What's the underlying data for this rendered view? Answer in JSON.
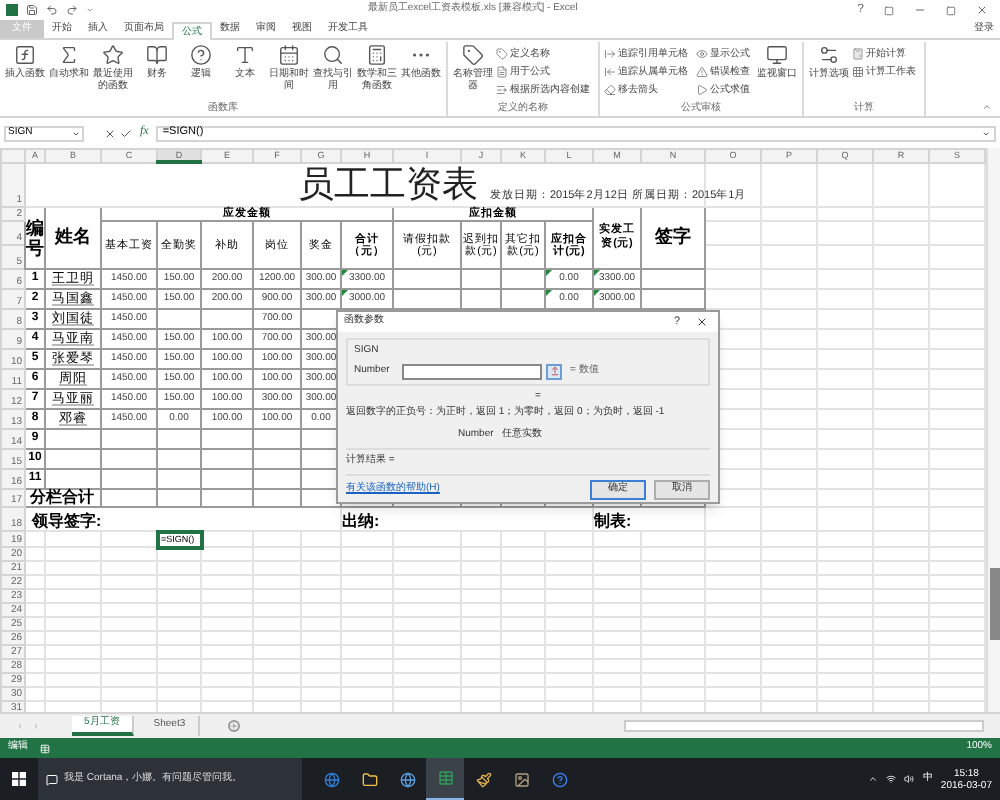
{
  "window": {
    "title": "最新员工excel工资表模板.xls  [兼容模式] - Excel",
    "help": "?"
  },
  "ribbon_tabs": [
    {
      "label": "文件",
      "kind": "file",
      "selected": false
    },
    {
      "label": "开始",
      "kind": "tab",
      "selected": false
    },
    {
      "label": "插入",
      "kind": "tab",
      "selected": false
    },
    {
      "label": "页面布局",
      "kind": "tab",
      "selected": false
    },
    {
      "label": "公式",
      "kind": "tab",
      "selected": true
    },
    {
      "label": "数据",
      "kind": "tab",
      "selected": false
    },
    {
      "label": "审阅",
      "kind": "tab",
      "selected": false
    },
    {
      "label": "视图",
      "kind": "tab",
      "selected": false
    },
    {
      "label": "开发工具",
      "kind": "tab",
      "selected": false
    }
  ],
  "sign_in": "登录",
  "ribbon_groups": [
    {
      "label": "函数库",
      "items": [
        {
          "label": "插入函数",
          "kind": "large"
        },
        {
          "label": "自动求和",
          "kind": "large"
        },
        {
          "label": "最近使用的函数",
          "kind": "large"
        },
        {
          "label": "财务",
          "kind": "large"
        },
        {
          "label": "逻辑",
          "kind": "large"
        },
        {
          "label": "文本",
          "kind": "large"
        },
        {
          "label": "日期和时间",
          "kind": "large"
        },
        {
          "label": "查找与引用",
          "kind": "large"
        },
        {
          "label": "数学和三角函数",
          "kind": "large"
        },
        {
          "label": "其他函数",
          "kind": "large"
        }
      ]
    },
    {
      "label": "定义的名称",
      "items": [
        {
          "label": "名称管理器",
          "kind": "large"
        },
        {
          "label": "定义名称",
          "kind": "small"
        },
        {
          "label": "用于公式",
          "kind": "small"
        },
        {
          "label": "根据所选内容创建",
          "kind": "small"
        }
      ]
    },
    {
      "label": "公式审核",
      "items": [
        {
          "label": "追踪引用单元格",
          "kind": "small"
        },
        {
          "label": "追踪从属单元格",
          "kind": "small"
        },
        {
          "label": "移去箭头",
          "kind": "small"
        },
        {
          "label": "显示公式",
          "kind": "small"
        },
        {
          "label": "错误检查",
          "kind": "small"
        },
        {
          "label": "公式求值",
          "kind": "small"
        },
        {
          "label": "监视窗口",
          "kind": "large"
        }
      ]
    },
    {
      "label": "计算",
      "items": [
        {
          "label": "计算选项",
          "kind": "large"
        },
        {
          "label": "开始计算",
          "kind": "small"
        },
        {
          "label": "计算工作表",
          "kind": "small"
        }
      ]
    }
  ],
  "formula_bar": {
    "name_box": "SIGN",
    "fx_label": "fx",
    "formula": "=SIGN()"
  },
  "sheet": {
    "columns": [
      "A",
      "B",
      "C",
      "D",
      "E",
      "F",
      "G",
      "H",
      "I",
      "J",
      "K",
      "L",
      "M",
      "N",
      "O",
      "P",
      "Q",
      "R",
      "S"
    ],
    "row_numbers": [
      "1",
      "2",
      "4",
      "5",
      "6",
      "7",
      "8",
      "9",
      "10",
      "11",
      "12",
      "13",
      "14",
      "15",
      "16",
      "17",
      "18",
      "19",
      "20",
      "21",
      "22",
      "23",
      "24",
      "25",
      "26",
      "27",
      "28",
      "29",
      "30",
      "31"
    ],
    "title": "员工工资表",
    "issue_info": "发放日期：2015年2月12日 所属日期：2015年1月",
    "headers": {
      "no": "编号",
      "name": "姓名",
      "payable": "应发金额",
      "payable_items": [
        "基本工资",
        "全勤奖",
        "补助",
        "岗位",
        "奖金",
        "合计（元）"
      ],
      "deduction": "应扣金额",
      "deduction_items": [
        "请假扣款(元)",
        "迟到扣款(元)",
        "其它扣款(元)",
        "应扣合计(元)"
      ],
      "net": "实发工资(元)",
      "sign": "签字"
    },
    "rows": [
      {
        "no": "1",
        "name": "王卫明",
        "flagged": true,
        "cells": {
          "C": "1450.00",
          "D": "150.00",
          "E": "200.00",
          "F": "1200.00",
          "G": "300.00",
          "H": "3300.00",
          "L": "0.00",
          "M": "3300.00"
        }
      },
      {
        "no": "2",
        "name": "马国鑫",
        "flagged": true,
        "cells": {
          "C": "1450.00",
          "D": "150.00",
          "E": "200.00",
          "F": "900.00",
          "G": "300.00",
          "H": "3000.00",
          "L": "0.00",
          "M": "3000.00"
        }
      },
      {
        "no": "3",
        "name": "刘国徒",
        "cells": {
          "C": "1450.00",
          "F": "700.00"
        }
      },
      {
        "no": "4",
        "name": "马亚南",
        "cells": {
          "C": "1450.00",
          "D": "150.00",
          "E": "100.00",
          "F": "700.00",
          "G": "300.00"
        }
      },
      {
        "no": "5",
        "name": "张爱琴",
        "cells": {
          "C": "1450.00",
          "D": "150.00",
          "E": "100.00",
          "F": "100.00",
          "G": "300.00"
        }
      },
      {
        "no": "6",
        "name": "周阳",
        "cells": {
          "C": "1450.00",
          "D": "150.00",
          "E": "100.00",
          "F": "100.00",
          "G": "300.00"
        }
      },
      {
        "no": "7",
        "name": "马亚丽",
        "cells": {
          "C": "1450.00",
          "D": "150.00",
          "E": "100.00",
          "F": "300.00",
          "G": "300.00"
        }
      },
      {
        "no": "8",
        "name": "邓睿",
        "cells": {
          "C": "1450.00",
          "D": "0.00",
          "E": "100.00",
          "F": "100.00",
          "G": "0.00"
        }
      },
      {
        "no": "9"
      },
      {
        "no": "10"
      },
      {
        "no": "11"
      }
    ],
    "subtotal": "分栏合计",
    "signatures": [
      "领导签字:",
      "出纳:",
      "制表:"
    ],
    "active_cell": "=SIGN()"
  },
  "dialog": {
    "title": "函数参数",
    "help": "?",
    "function_name": "SIGN",
    "argument_label": "Number",
    "argument_hint": "= 数值",
    "equals": "=",
    "description": "返回数字的正负号：为正时，返回 1；为零时，返回 0；为负时，返回 -1",
    "argument_name": "Number",
    "argument_description": "任意实数",
    "result": "计算结果 =",
    "help_link": "有关该函数的帮助(H)",
    "ok": "确定",
    "cancel": "取消"
  },
  "sheet_tabs": [
    {
      "label": "5月工资",
      "selected": true
    },
    {
      "label": "Sheet3",
      "selected": false
    }
  ],
  "status_bar": {
    "mode": "编辑",
    "zoom": "100%"
  },
  "taskbar": {
    "search_placeholder": "我是 Cortana，小娜。有问题尽管问我。",
    "apps": [
      {
        "selected": false
      },
      {
        "selected": false
      },
      {
        "selected": false
      },
      {
        "selected": true
      },
      {
        "selected": false
      },
      {
        "selected": false
      },
      {
        "selected": false
      }
    ],
    "ime": "中",
    "time": "15:18",
    "date": "2016-03-07"
  }
}
